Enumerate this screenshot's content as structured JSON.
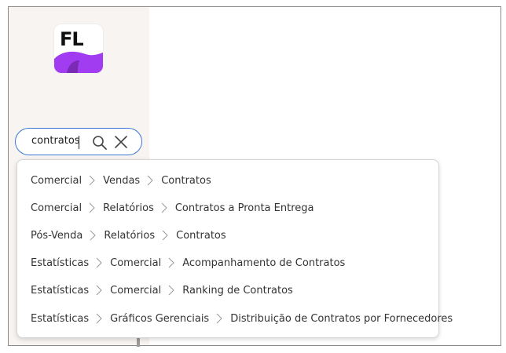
{
  "logo": {
    "text": "FL",
    "colors": {
      "primary": "#a23cf0",
      "secondary": "#7a2bb5"
    }
  },
  "search": {
    "value": "contratos",
    "search_icon": "search-icon",
    "clear_icon": "close-icon",
    "border_color": "#3a78d4"
  },
  "results": [
    {
      "parts": [
        "Comercial",
        "Vendas",
        "Contratos"
      ]
    },
    {
      "parts": [
        "Comercial",
        "Relatórios",
        "Contratos a Pronta Entrega"
      ]
    },
    {
      "parts": [
        "Pós-Venda",
        "Relatórios",
        "Contratos"
      ]
    },
    {
      "parts": [
        "Estatísticas",
        "Comercial",
        "Acompanhamento de Contratos"
      ]
    },
    {
      "parts": [
        "Estatísticas",
        "Comercial",
        "Ranking de Contratos"
      ]
    },
    {
      "parts": [
        "Estatísticas",
        "Gráficos Gerenciais",
        "Distribuição de Contratos por Fornecedores"
      ]
    }
  ],
  "separator_icon": "chevron-right-icon"
}
